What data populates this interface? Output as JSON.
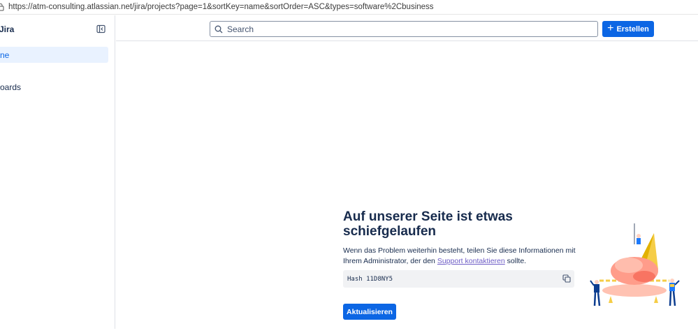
{
  "browser": {
    "url": "https://atm-consulting.atlassian.net/jira/projects?page=1&sortKey=name&sortOrder=ASC&types=software%2Cbusiness"
  },
  "sidebar": {
    "title": "Jira",
    "items": [
      {
        "label": "ne",
        "active": true
      },
      {
        "label": "oards",
        "active": false
      }
    ]
  },
  "topnav": {
    "search_placeholder": "Search",
    "create_label": "Erstellen"
  },
  "error": {
    "title": "Auf unserer Seite ist etwas schiefgelaufen",
    "body_before": "Wenn das Problem weiterhin besteht, teilen Sie diese Informationen mit Ihrem Administrator, der den ",
    "support_link": "Support kontaktieren",
    "body_after": " sollte.",
    "hash": "Hash 11D8NY5",
    "refresh_label": "Aktualisieren"
  },
  "colors": {
    "primary": "#0c66e4",
    "active_bg": "#e9f2ff",
    "link": "#6e5dc6",
    "text": "#172b4d",
    "code_bg": "#f1f2f4"
  },
  "icons": [
    "lock-icon",
    "sidebar-collapse-icon",
    "search-icon",
    "plus-icon",
    "copy-icon"
  ]
}
